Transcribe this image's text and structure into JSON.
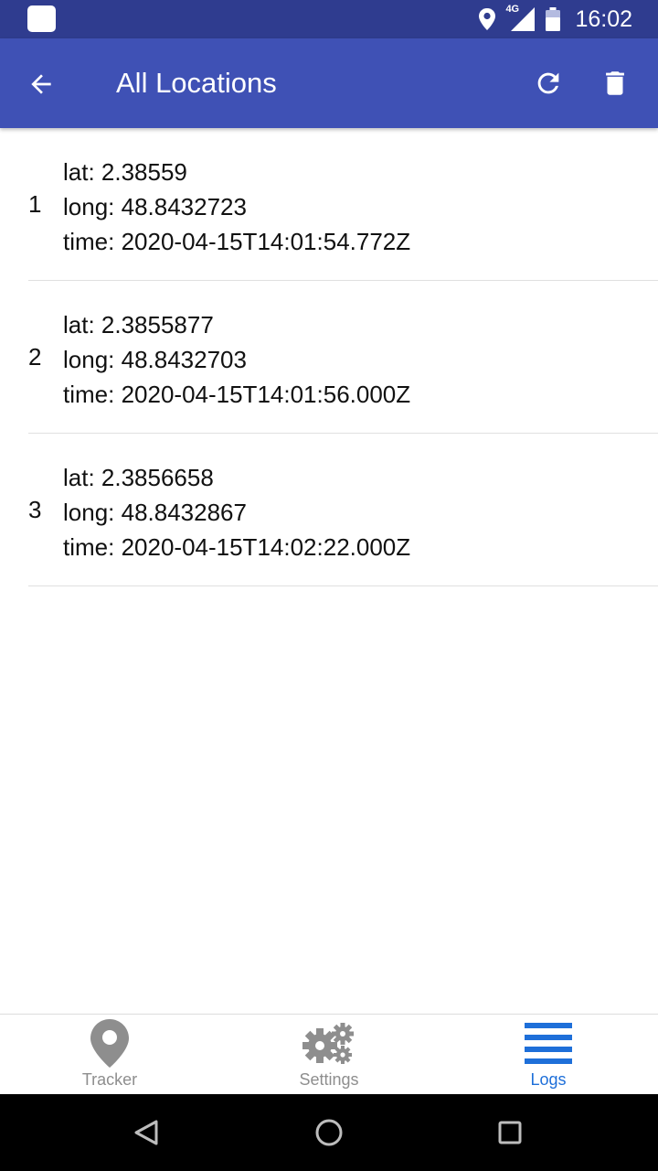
{
  "status_bar": {
    "time": "16:02",
    "network": "4G"
  },
  "app_bar": {
    "title": "All Locations"
  },
  "locations": [
    {
      "index": "1",
      "lat": "lat: 2.38559",
      "long": "long: 48.8432723",
      "time": "time: 2020-04-15T14:01:54.772Z"
    },
    {
      "index": "2",
      "lat": "lat: 2.3855877",
      "long": "long: 48.8432703",
      "time": "time: 2020-04-15T14:01:56.000Z"
    },
    {
      "index": "3",
      "lat": "lat: 2.3856658",
      "long": "long: 48.8432867",
      "time": "time: 2020-04-15T14:02:22.000Z"
    }
  ],
  "tabs": [
    {
      "label": "Tracker",
      "icon": "location-pin-icon",
      "active": false
    },
    {
      "label": "Settings",
      "icon": "gears-icon",
      "active": false
    },
    {
      "label": "Logs",
      "icon": "menu-lines-icon",
      "active": true
    }
  ],
  "colors": {
    "status_bar": "#2f3c8f",
    "app_bar": "#3f51b5",
    "tab_active": "#1e6fd9",
    "tab_inactive": "#8e8e8e"
  }
}
